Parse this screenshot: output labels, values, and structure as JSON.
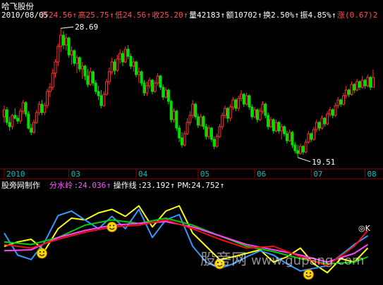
{
  "stock": {
    "name": "哈飞股份",
    "date": "2010/08/05",
    "quote": [
      {
        "label": "开",
        "value": "24.56",
        "color": "#ff5050"
      },
      {
        "label": "高",
        "value": "25.75",
        "color": "#ff5050"
      },
      {
        "label": "低",
        "value": "24.56",
        "color": "#ff5050"
      },
      {
        "label": "收",
        "value": "25.20",
        "color": "#ff5050"
      },
      {
        "label": "量",
        "value": "42183",
        "color": "#ffffff"
      },
      {
        "label": "额",
        "value": "10702",
        "color": "#ffffff"
      },
      {
        "label": "换",
        "value": "2.50%",
        "color": "#ffffff"
      },
      {
        "label": "振",
        "value": "4.85%",
        "color": "#ffffff"
      },
      {
        "label": "涨",
        "value": "(0.67)2",
        "color": "#ff5050"
      }
    ]
  },
  "indicator": {
    "name": "股旁网制作",
    "lines": [
      {
        "label": "分水岭",
        "value": "24.036",
        "color": "#ff55ff"
      },
      {
        "label": "操作线",
        "value": "23.192",
        "color": "#ffffff"
      },
      {
        "label": "PM",
        "value": "24.752",
        "color": "#ffffff"
      }
    ]
  },
  "watermark": {
    "cn": "股旁网",
    "url": "www.gupang.com"
  },
  "corner_mark": "◎K",
  "colors": {
    "up": "#ff3232",
    "down": "#00e000",
    "grid": "#8b0000",
    "axis_text": "#00c0c0",
    "yellow": "#ffff00",
    "cyan": "#3399ff",
    "green": "#00d000",
    "magenta": "#ff44ff",
    "red": "#ee1111"
  },
  "chart_data": [
    {
      "type": "candlestick",
      "annotations": [
        {
          "text": "28.69",
          "kind": "high"
        },
        {
          "text": "19.51",
          "kind": "low"
        }
      ],
      "x_ticks": [
        "2010",
        "03",
        "04",
        "05",
        "06",
        "07",
        "08"
      ],
      "tick_index": [
        0,
        24,
        49,
        72,
        93,
        114,
        134
      ],
      "ylim": [
        19.2,
        29.2
      ],
      "ohlc": [
        [
          22.4,
          23.2,
          22.0,
          22.9
        ],
        [
          22.9,
          23.1,
          21.8,
          22.0
        ],
        [
          22.0,
          22.4,
          21.4,
          21.7
        ],
        [
          21.7,
          22.6,
          21.5,
          22.5
        ],
        [
          22.5,
          23.0,
          22.2,
          22.3
        ],
        [
          22.3,
          22.5,
          21.9,
          22.1
        ],
        [
          22.1,
          23.0,
          21.9,
          22.8
        ],
        [
          22.8,
          23.6,
          22.6,
          23.4
        ],
        [
          23.4,
          23.5,
          22.4,
          22.6
        ],
        [
          22.6,
          22.8,
          21.5,
          21.6
        ],
        [
          21.6,
          21.9,
          21.1,
          21.3
        ],
        [
          21.3,
          22.2,
          21.2,
          22.0
        ],
        [
          22.0,
          22.9,
          21.9,
          22.7
        ],
        [
          22.7,
          23.5,
          22.5,
          23.3
        ],
        [
          23.3,
          23.6,
          22.5,
          22.7
        ],
        [
          22.7,
          23.4,
          22.5,
          23.2
        ],
        [
          23.2,
          24.4,
          23.0,
          24.2
        ],
        [
          24.2,
          24.8,
          23.8,
          24.5
        ],
        [
          24.5,
          25.8,
          24.3,
          25.5
        ],
        [
          25.5,
          26.5,
          25.2,
          26.3
        ],
        [
          26.3,
          27.6,
          26.0,
          27.4
        ],
        [
          27.4,
          28.69,
          27.0,
          28.2
        ],
        [
          28.2,
          28.5,
          27.2,
          27.5
        ],
        [
          27.5,
          28.3,
          27.1,
          28.0
        ],
        [
          28.0,
          28.1,
          26.6,
          26.8
        ],
        [
          26.8,
          27.4,
          26.1,
          27.1
        ],
        [
          27.1,
          27.2,
          26.0,
          26.2
        ],
        [
          26.2,
          26.8,
          25.5,
          26.6
        ],
        [
          26.6,
          26.7,
          25.6,
          25.8
        ],
        [
          25.8,
          26.3,
          25.1,
          26.0
        ],
        [
          26.0,
          26.1,
          25.0,
          25.3
        ],
        [
          25.3,
          25.8,
          24.5,
          24.7
        ],
        [
          24.7,
          25.9,
          24.6,
          25.6
        ],
        [
          25.6,
          25.7,
          24.6,
          24.8
        ],
        [
          24.8,
          25.0,
          24.0,
          24.2
        ],
        [
          24.2,
          24.6,
          23.6,
          23.9
        ],
        [
          23.9,
          24.3,
          23.0,
          23.2
        ],
        [
          23.2,
          24.2,
          23.1,
          24.0
        ],
        [
          24.0,
          25.1,
          23.9,
          24.9
        ],
        [
          24.9,
          25.9,
          24.7,
          25.6
        ],
        [
          25.6,
          26.6,
          25.4,
          26.3
        ],
        [
          26.3,
          26.5,
          25.4,
          25.7
        ],
        [
          25.7,
          26.8,
          25.6,
          26.5
        ],
        [
          26.5,
          27.2,
          26.2,
          26.9
        ],
        [
          26.9,
          27.1,
          26.0,
          26.3
        ],
        [
          26.3,
          27.4,
          26.2,
          27.2
        ],
        [
          27.2,
          27.5,
          26.5,
          26.7
        ],
        [
          26.7,
          26.9,
          25.8,
          26.0
        ],
        [
          26.0,
          26.6,
          25.6,
          26.3
        ],
        [
          26.3,
          26.4,
          25.2,
          25.4
        ],
        [
          25.4,
          25.9,
          24.8,
          25.6
        ],
        [
          25.6,
          25.7,
          24.6,
          24.8
        ],
        [
          24.8,
          25.0,
          23.9,
          24.1
        ],
        [
          24.1,
          24.9,
          23.9,
          24.6
        ],
        [
          24.6,
          25.2,
          24.4,
          25.0
        ],
        [
          25.0,
          25.1,
          24.0,
          24.2
        ],
        [
          24.2,
          25.0,
          24.1,
          24.8
        ],
        [
          24.8,
          25.5,
          24.6,
          25.3
        ],
        [
          25.3,
          25.4,
          24.3,
          24.5
        ],
        [
          24.5,
          24.7,
          23.6,
          23.8
        ],
        [
          23.8,
          24.5,
          23.7,
          24.3
        ],
        [
          24.3,
          24.4,
          23.3,
          23.5
        ],
        [
          23.5,
          23.6,
          22.0,
          22.2
        ],
        [
          22.2,
          23.0,
          22.0,
          22.8
        ],
        [
          22.8,
          22.9,
          21.4,
          21.6
        ],
        [
          21.6,
          21.8,
          20.6,
          20.9
        ],
        [
          20.9,
          21.3,
          20.2,
          20.4
        ],
        [
          20.4,
          21.4,
          20.3,
          21.2
        ],
        [
          21.2,
          22.3,
          21.1,
          22.0
        ],
        [
          22.0,
          22.8,
          21.8,
          22.5
        ],
        [
          22.5,
          23.6,
          22.3,
          23.3
        ],
        [
          23.3,
          23.4,
          22.2,
          22.4
        ],
        [
          22.4,
          22.6,
          21.6,
          21.8
        ],
        [
          21.8,
          22.6,
          21.7,
          22.4
        ],
        [
          22.4,
          22.5,
          21.5,
          21.7
        ],
        [
          21.7,
          21.9,
          20.8,
          21.0
        ],
        [
          21.0,
          21.8,
          20.8,
          21.6
        ],
        [
          21.6,
          21.7,
          20.6,
          20.8
        ],
        [
          20.8,
          21.0,
          20.1,
          20.3
        ],
        [
          20.3,
          21.2,
          20.2,
          21.0
        ],
        [
          21.0,
          21.9,
          20.9,
          21.7
        ],
        [
          21.7,
          22.7,
          21.5,
          22.5
        ],
        [
          22.5,
          23.2,
          22.3,
          23.0
        ],
        [
          23.0,
          23.1,
          22.0,
          22.3
        ],
        [
          22.3,
          23.3,
          22.1,
          23.1
        ],
        [
          23.1,
          23.8,
          22.9,
          23.6
        ],
        [
          23.6,
          23.7,
          22.8,
          23.0
        ],
        [
          23.0,
          23.9,
          22.8,
          23.7
        ],
        [
          23.7,
          24.3,
          23.5,
          24.0
        ],
        [
          24.0,
          24.1,
          23.1,
          23.3
        ],
        [
          23.3,
          24.1,
          23.2,
          23.9
        ],
        [
          23.9,
          24.0,
          22.9,
          23.1
        ],
        [
          23.1,
          23.3,
          22.2,
          22.4
        ],
        [
          22.4,
          23.1,
          22.3,
          22.9
        ],
        [
          22.9,
          23.0,
          22.0,
          22.2
        ],
        [
          22.2,
          23.0,
          22.1,
          22.8
        ],
        [
          22.8,
          23.5,
          22.6,
          23.3
        ],
        [
          23.3,
          23.4,
          22.3,
          22.5
        ],
        [
          22.5,
          22.7,
          21.5,
          21.7
        ],
        [
          21.7,
          22.4,
          21.6,
          22.2
        ],
        [
          22.2,
          22.3,
          21.2,
          21.4
        ],
        [
          21.4,
          22.2,
          21.3,
          22.0
        ],
        [
          22.0,
          22.1,
          21.2,
          21.4
        ],
        [
          21.4,
          21.9,
          20.8,
          21.7
        ],
        [
          21.7,
          21.8,
          21.0,
          21.2
        ],
        [
          21.2,
          21.4,
          20.5,
          20.7
        ],
        [
          20.7,
          21.5,
          20.6,
          21.3
        ],
        [
          21.3,
          21.4,
          20.2,
          20.4
        ],
        [
          20.4,
          20.6,
          19.8,
          20.0
        ],
        [
          20.0,
          20.4,
          19.51,
          19.8
        ],
        [
          19.8,
          20.5,
          19.7,
          20.3
        ],
        [
          20.3,
          20.4,
          19.7,
          19.9
        ],
        [
          19.9,
          20.8,
          19.8,
          20.6
        ],
        [
          20.6,
          21.4,
          20.5,
          21.2
        ],
        [
          21.2,
          21.3,
          20.6,
          20.8
        ],
        [
          20.8,
          21.7,
          20.7,
          21.5
        ],
        [
          21.5,
          22.2,
          21.3,
          22.0
        ],
        [
          22.0,
          22.1,
          21.4,
          21.6
        ],
        [
          21.6,
          22.5,
          21.5,
          22.3
        ],
        [
          22.3,
          22.4,
          21.7,
          21.9
        ],
        [
          21.9,
          22.8,
          21.8,
          22.6
        ],
        [
          22.6,
          23.1,
          22.4,
          22.9
        ],
        [
          22.9,
          23.0,
          22.3,
          22.5
        ],
        [
          22.5,
          23.4,
          22.4,
          23.2
        ],
        [
          23.2,
          23.8,
          23.0,
          23.6
        ],
        [
          23.6,
          23.7,
          23.1,
          23.3
        ],
        [
          23.3,
          24.1,
          23.2,
          23.9
        ],
        [
          23.9,
          24.6,
          23.7,
          24.3
        ],
        [
          24.3,
          24.4,
          23.8,
          24.0
        ],
        [
          24.0,
          24.9,
          23.9,
          24.7
        ],
        [
          24.7,
          24.8,
          24.1,
          24.3
        ],
        [
          24.3,
          25.1,
          24.2,
          24.9
        ],
        [
          24.9,
          25.0,
          24.3,
          24.5
        ],
        [
          24.5,
          25.3,
          24.4,
          25.0
        ],
        [
          25.0,
          25.1,
          24.4,
          24.6
        ],
        [
          24.6,
          25.4,
          24.5,
          25.2
        ],
        [
          25.2,
          25.3,
          24.3,
          24.5
        ],
        [
          24.5,
          25.75,
          24.56,
          25.2
        ]
      ]
    },
    {
      "type": "line",
      "ylim": [
        0,
        100
      ],
      "series": [
        {
          "label": "PM",
          "color": "yellow",
          "x": [
            0,
            5,
            10,
            15,
            20,
            25,
            30,
            35,
            40,
            45,
            50,
            55,
            60,
            65,
            70,
            75,
            80,
            85,
            90,
            95,
            100,
            105,
            110,
            115,
            120,
            125,
            130,
            135
          ],
          "y": [
            40,
            45,
            48,
            35,
            60,
            72,
            70,
            78,
            82,
            74,
            86,
            62,
            80,
            86,
            55,
            40,
            25,
            28,
            32,
            36,
            22,
            28,
            38,
            20,
            10,
            26,
            22,
            38
          ]
        },
        {
          "label": "",
          "color": "cyan",
          "x": [
            0,
            5,
            10,
            15,
            20,
            25,
            30,
            35,
            40,
            45,
            50,
            55,
            60,
            65,
            70,
            75,
            80,
            85,
            90,
            95,
            100,
            105,
            110,
            115,
            120,
            125,
            130,
            135
          ],
          "y": [
            55,
            30,
            25,
            45,
            75,
            80,
            70,
            60,
            74,
            60,
            82,
            50,
            70,
            76,
            40,
            22,
            15,
            20,
            28,
            35,
            30,
            20,
            12,
            15,
            18,
            30,
            42,
            52
          ]
        },
        {
          "label": "操作线",
          "color": "green",
          "x": [
            0,
            10,
            20,
            30,
            40,
            50,
            60,
            70,
            80,
            90,
            100,
            110,
            120,
            130,
            135
          ],
          "y": [
            45,
            42,
            50,
            64,
            70,
            66,
            72,
            64,
            52,
            40,
            34,
            26,
            20,
            22,
            28
          ]
        },
        {
          "label": "分水岭",
          "color": "magenta",
          "x": [
            0,
            10,
            20,
            30,
            40,
            50,
            60,
            70,
            80,
            90,
            100,
            110,
            120,
            130,
            135
          ],
          "y": [
            35,
            36,
            50,
            58,
            64,
            66,
            68,
            62,
            52,
            42,
            36,
            30,
            22,
            32,
            42
          ]
        },
        {
          "label": "",
          "color": "red",
          "x": [
            0,
            10,
            20,
            30,
            40,
            50,
            60,
            70,
            80,
            90,
            100,
            110,
            120,
            130,
            135
          ],
          "y": [
            42,
            38,
            48,
            56,
            62,
            64,
            70,
            60,
            48,
            38,
            40,
            28,
            18,
            40,
            58
          ]
        }
      ],
      "signals": [
        {
          "x": 14,
          "y": 32
        },
        {
          "x": 40,
          "y": 62
        },
        {
          "x": 80,
          "y": 20
        },
        {
          "x": 113,
          "y": 8
        }
      ]
    }
  ]
}
